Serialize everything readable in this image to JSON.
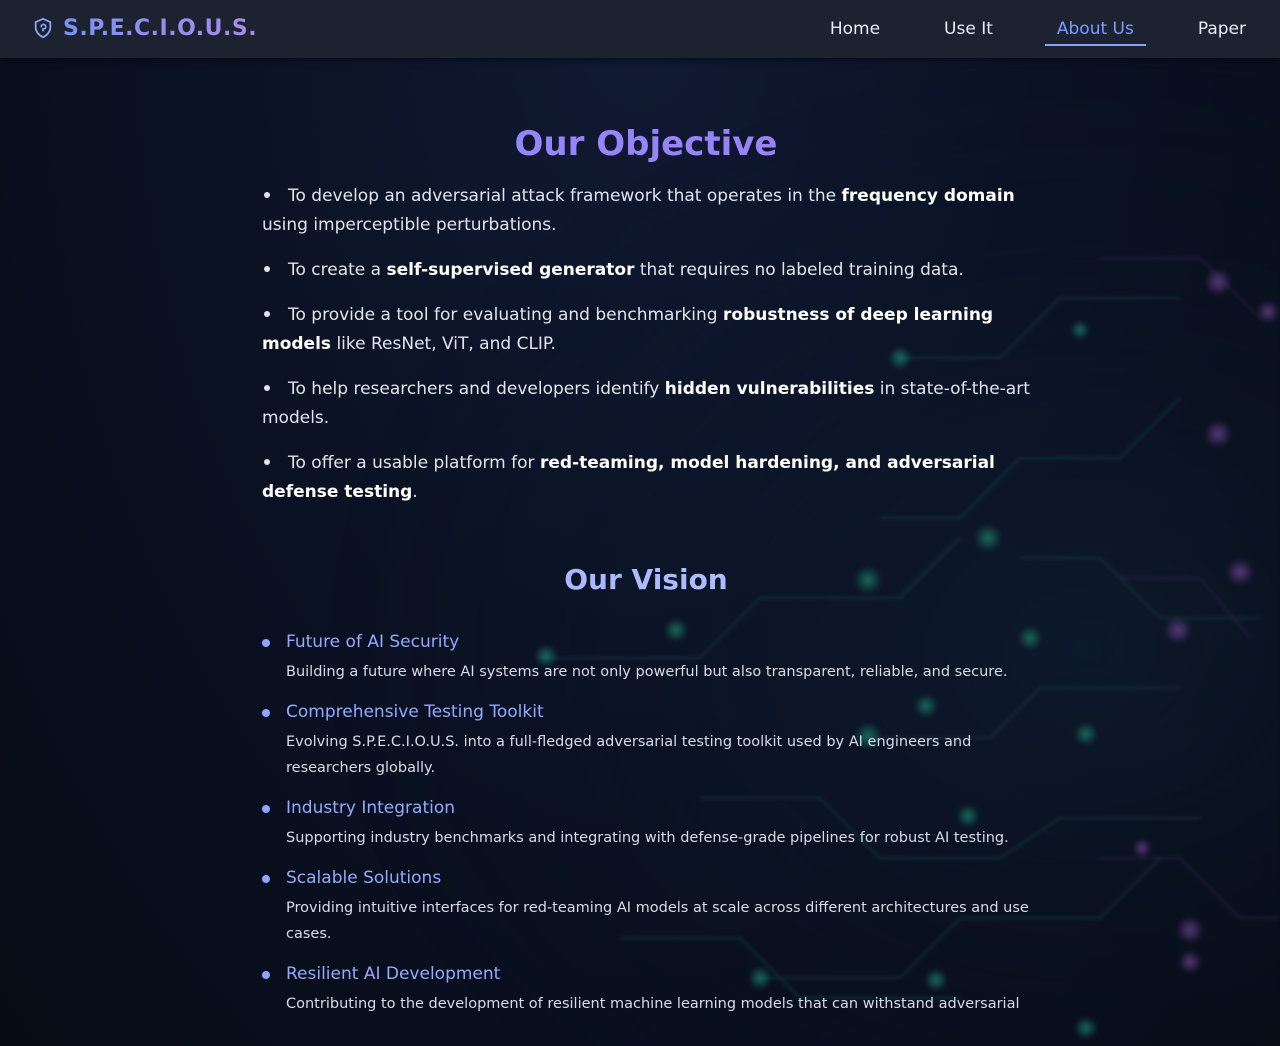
{
  "navbar": {
    "brand": "S.P.E.C.I.O.U.S.",
    "logo_icon": "shield-icon",
    "links": [
      {
        "label": "Home",
        "active": false
      },
      {
        "label": "Use It",
        "active": false
      },
      {
        "label": "About Us",
        "active": true
      },
      {
        "label": "Paper",
        "active": false
      }
    ],
    "active_color": "#7e9bff"
  },
  "objective": {
    "title": "Our Objective",
    "items": [
      {
        "pre": "To develop an adversarial attack framework that operates in the ",
        "bold": "frequency domain",
        "post": " using imperceptible perturbations."
      },
      {
        "pre": "To create a ",
        "bold": "self-supervised generator",
        "post": " that requires no labeled training data."
      },
      {
        "pre": "To provide a tool for evaluating and benchmarking ",
        "bold": "robustness of deep learning models",
        "post": " like ResNet, ViT, and CLIP."
      },
      {
        "pre": "To help researchers and developers identify ",
        "bold": "hidden vulnerabilities",
        "post": " in state-of-the-art models."
      },
      {
        "pre": "To offer a usable platform for ",
        "bold": "red-teaming, model hardening, and adversarial defense testing",
        "post": "."
      }
    ]
  },
  "vision": {
    "title": "Our Vision",
    "items": [
      {
        "heading": "Future of AI Security",
        "desc": "Building a future where AI systems are not only powerful but also transparent, reliable, and secure."
      },
      {
        "heading": "Comprehensive Testing Toolkit",
        "desc": "Evolving S.P.E.C.I.O.U.S. into a full-fledged adversarial testing toolkit used by AI engineers and researchers globally."
      },
      {
        "heading": "Industry Integration",
        "desc": "Supporting industry benchmarks and integrating with defense-grade pipelines for robust AI testing."
      },
      {
        "heading": "Scalable Solutions",
        "desc": "Providing intuitive interfaces for red-teaming AI models at scale across different architectures and use cases."
      },
      {
        "heading": "Resilient AI Development",
        "desc": "Contributing to the development of resilient machine learning models that can withstand adversarial"
      }
    ]
  },
  "colors": {
    "navbar_bg": "#1c2230",
    "page_bg": "#0b1020",
    "accent": "#8ea6ff",
    "title_gradient_start": "#8f8bff",
    "title_gradient_end": "#9c7ef2"
  }
}
